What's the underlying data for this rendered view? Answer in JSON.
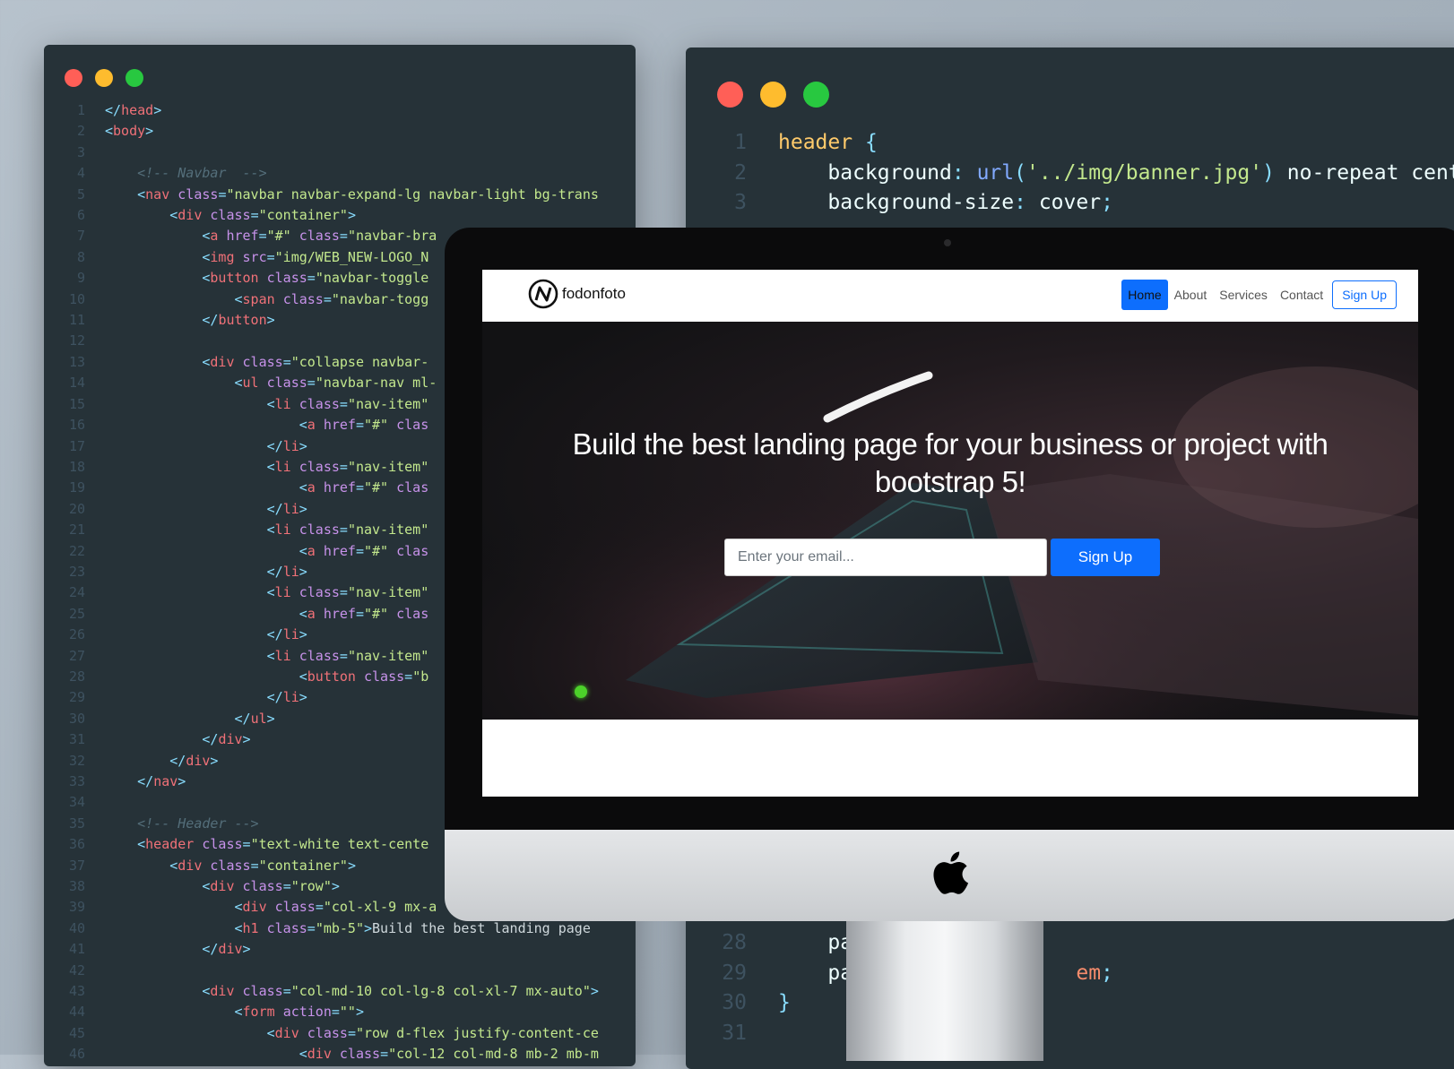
{
  "colors": {
    "dot_red": "#ff5f57",
    "dot_yellow": "#febc2e",
    "dot_green": "#28c840",
    "editor_bg": "#263238",
    "primary": "#0d6efd"
  },
  "html_editor": {
    "lines": [
      {
        "n": "1",
        "segs": [
          [
            "t-punct",
            "</"
          ],
          [
            "t-tag",
            "head"
          ],
          [
            "t-punct",
            ">"
          ]
        ],
        "indent": ""
      },
      {
        "n": "2",
        "segs": [
          [
            "t-punct",
            "<"
          ],
          [
            "t-tag",
            "body"
          ],
          [
            "t-punct",
            ">"
          ]
        ],
        "indent": ""
      },
      {
        "n": "3",
        "segs": [],
        "indent": ""
      },
      {
        "n": "4",
        "segs": [
          [
            "t-cmt",
            "<!-- Navbar  -->"
          ]
        ],
        "indent": "    "
      },
      {
        "n": "5",
        "segs": [
          [
            "t-punct",
            "<"
          ],
          [
            "t-tag",
            "nav "
          ],
          [
            "t-attr",
            "class"
          ],
          [
            "t-punct",
            "="
          ],
          [
            "t-str",
            "\"navbar navbar-expand-lg navbar-light bg-trans"
          ]
        ],
        "indent": "    "
      },
      {
        "n": "6",
        "segs": [
          [
            "t-punct",
            "<"
          ],
          [
            "t-tag",
            "div "
          ],
          [
            "t-attr",
            "class"
          ],
          [
            "t-punct",
            "="
          ],
          [
            "t-str",
            "\"container\""
          ],
          [
            "t-punct",
            ">"
          ]
        ],
        "indent": "        "
      },
      {
        "n": "7",
        "segs": [
          [
            "t-punct",
            "<"
          ],
          [
            "t-tag",
            "a "
          ],
          [
            "t-attr",
            "href"
          ],
          [
            "t-punct",
            "="
          ],
          [
            "t-str",
            "\"#\" "
          ],
          [
            "t-attr",
            "class"
          ],
          [
            "t-punct",
            "="
          ],
          [
            "t-str",
            "\"navbar-bra"
          ]
        ],
        "indent": "            "
      },
      {
        "n": "8",
        "segs": [
          [
            "t-punct",
            "<"
          ],
          [
            "t-tag",
            "img "
          ],
          [
            "t-attr",
            "src"
          ],
          [
            "t-punct",
            "="
          ],
          [
            "t-str",
            "\"img/WEB_NEW-LOGO_N"
          ]
        ],
        "indent": "            "
      },
      {
        "n": "9",
        "segs": [
          [
            "t-punct",
            "<"
          ],
          [
            "t-tag",
            "button "
          ],
          [
            "t-attr",
            "class"
          ],
          [
            "t-punct",
            "="
          ],
          [
            "t-str",
            "\"navbar-toggle"
          ]
        ],
        "indent": "            "
      },
      {
        "n": "10",
        "segs": [
          [
            "t-punct",
            "<"
          ],
          [
            "t-tag",
            "span "
          ],
          [
            "t-attr",
            "class"
          ],
          [
            "t-punct",
            "="
          ],
          [
            "t-str",
            "\"navbar-togg"
          ]
        ],
        "indent": "                "
      },
      {
        "n": "11",
        "segs": [
          [
            "t-punct",
            "</"
          ],
          [
            "t-tag",
            "button"
          ],
          [
            "t-punct",
            ">"
          ]
        ],
        "indent": "            "
      },
      {
        "n": "12",
        "segs": [],
        "indent": ""
      },
      {
        "n": "13",
        "segs": [
          [
            "t-punct",
            "<"
          ],
          [
            "t-tag",
            "div "
          ],
          [
            "t-attr",
            "class"
          ],
          [
            "t-punct",
            "="
          ],
          [
            "t-str",
            "\"collapse navbar-"
          ]
        ],
        "indent": "            "
      },
      {
        "n": "14",
        "segs": [
          [
            "t-punct",
            "<"
          ],
          [
            "t-tag",
            "ul "
          ],
          [
            "t-attr",
            "class"
          ],
          [
            "t-punct",
            "="
          ],
          [
            "t-str",
            "\"navbar-nav ml-"
          ]
        ],
        "indent": "                "
      },
      {
        "n": "15",
        "segs": [
          [
            "t-punct",
            "<"
          ],
          [
            "t-tag",
            "li "
          ],
          [
            "t-attr",
            "class"
          ],
          [
            "t-punct",
            "="
          ],
          [
            "t-str",
            "\"nav-item\""
          ]
        ],
        "indent": "                    "
      },
      {
        "n": "16",
        "segs": [
          [
            "t-punct",
            "<"
          ],
          [
            "t-tag",
            "a "
          ],
          [
            "t-attr",
            "href"
          ],
          [
            "t-punct",
            "="
          ],
          [
            "t-str",
            "\"#\" "
          ],
          [
            "t-attr",
            "clas"
          ]
        ],
        "indent": "                        "
      },
      {
        "n": "17",
        "segs": [
          [
            "t-punct",
            "</"
          ],
          [
            "t-tag",
            "li"
          ],
          [
            "t-punct",
            ">"
          ]
        ],
        "indent": "                    "
      },
      {
        "n": "18",
        "segs": [
          [
            "t-punct",
            "<"
          ],
          [
            "t-tag",
            "li "
          ],
          [
            "t-attr",
            "class"
          ],
          [
            "t-punct",
            "="
          ],
          [
            "t-str",
            "\"nav-item\""
          ]
        ],
        "indent": "                    "
      },
      {
        "n": "19",
        "segs": [
          [
            "t-punct",
            "<"
          ],
          [
            "t-tag",
            "a "
          ],
          [
            "t-attr",
            "href"
          ],
          [
            "t-punct",
            "="
          ],
          [
            "t-str",
            "\"#\" "
          ],
          [
            "t-attr",
            "clas"
          ]
        ],
        "indent": "                        "
      },
      {
        "n": "20",
        "segs": [
          [
            "t-punct",
            "</"
          ],
          [
            "t-tag",
            "li"
          ],
          [
            "t-punct",
            ">"
          ]
        ],
        "indent": "                    "
      },
      {
        "n": "21",
        "segs": [
          [
            "t-punct",
            "<"
          ],
          [
            "t-tag",
            "li "
          ],
          [
            "t-attr",
            "class"
          ],
          [
            "t-punct",
            "="
          ],
          [
            "t-str",
            "\"nav-item\""
          ]
        ],
        "indent": "                    "
      },
      {
        "n": "22",
        "segs": [
          [
            "t-punct",
            "<"
          ],
          [
            "t-tag",
            "a "
          ],
          [
            "t-attr",
            "href"
          ],
          [
            "t-punct",
            "="
          ],
          [
            "t-str",
            "\"#\" "
          ],
          [
            "t-attr",
            "clas"
          ]
        ],
        "indent": "                        "
      },
      {
        "n": "23",
        "segs": [
          [
            "t-punct",
            "</"
          ],
          [
            "t-tag",
            "li"
          ],
          [
            "t-punct",
            ">"
          ]
        ],
        "indent": "                    "
      },
      {
        "n": "24",
        "segs": [
          [
            "t-punct",
            "<"
          ],
          [
            "t-tag",
            "li "
          ],
          [
            "t-attr",
            "class"
          ],
          [
            "t-punct",
            "="
          ],
          [
            "t-str",
            "\"nav-item\""
          ]
        ],
        "indent": "                    "
      },
      {
        "n": "25",
        "segs": [
          [
            "t-punct",
            "<"
          ],
          [
            "t-tag",
            "a "
          ],
          [
            "t-attr",
            "href"
          ],
          [
            "t-punct",
            "="
          ],
          [
            "t-str",
            "\"#\" "
          ],
          [
            "t-attr",
            "clas"
          ]
        ],
        "indent": "                        "
      },
      {
        "n": "26",
        "segs": [
          [
            "t-punct",
            "</"
          ],
          [
            "t-tag",
            "li"
          ],
          [
            "t-punct",
            ">"
          ]
        ],
        "indent": "                    "
      },
      {
        "n": "27",
        "segs": [
          [
            "t-punct",
            "<"
          ],
          [
            "t-tag",
            "li "
          ],
          [
            "t-attr",
            "class"
          ],
          [
            "t-punct",
            "="
          ],
          [
            "t-str",
            "\"nav-item\""
          ]
        ],
        "indent": "                    "
      },
      {
        "n": "28",
        "segs": [
          [
            "t-punct",
            "<"
          ],
          [
            "t-tag",
            "button "
          ],
          [
            "t-attr",
            "class"
          ],
          [
            "t-punct",
            "="
          ],
          [
            "t-str",
            "\"b"
          ]
        ],
        "indent": "                        "
      },
      {
        "n": "29",
        "segs": [
          [
            "t-punct",
            "</"
          ],
          [
            "t-tag",
            "li"
          ],
          [
            "t-punct",
            ">"
          ]
        ],
        "indent": "                    "
      },
      {
        "n": "30",
        "segs": [
          [
            "t-punct",
            "</"
          ],
          [
            "t-tag",
            "ul"
          ],
          [
            "t-punct",
            ">"
          ]
        ],
        "indent": "                "
      },
      {
        "n": "31",
        "segs": [
          [
            "t-punct",
            "</"
          ],
          [
            "t-tag",
            "div"
          ],
          [
            "t-punct",
            ">"
          ]
        ],
        "indent": "            "
      },
      {
        "n": "32",
        "segs": [
          [
            "t-punct",
            "</"
          ],
          [
            "t-tag",
            "div"
          ],
          [
            "t-punct",
            ">"
          ]
        ],
        "indent": "        "
      },
      {
        "n": "33",
        "segs": [
          [
            "t-punct",
            "</"
          ],
          [
            "t-tag",
            "nav"
          ],
          [
            "t-punct",
            ">"
          ]
        ],
        "indent": "    "
      },
      {
        "n": "34",
        "segs": [],
        "indent": ""
      },
      {
        "n": "35",
        "segs": [
          [
            "t-cmt",
            "<!-- Header -->"
          ]
        ],
        "indent": "    "
      },
      {
        "n": "36",
        "segs": [
          [
            "t-punct",
            "<"
          ],
          [
            "t-tag",
            "header "
          ],
          [
            "t-attr",
            "class"
          ],
          [
            "t-punct",
            "="
          ],
          [
            "t-str",
            "\"text-white text-cente"
          ]
        ],
        "indent": "    "
      },
      {
        "n": "37",
        "segs": [
          [
            "t-punct",
            "<"
          ],
          [
            "t-tag",
            "div "
          ],
          [
            "t-attr",
            "class"
          ],
          [
            "t-punct",
            "="
          ],
          [
            "t-str",
            "\"container\""
          ],
          [
            "t-punct",
            ">"
          ]
        ],
        "indent": "        "
      },
      {
        "n": "38",
        "segs": [
          [
            "t-punct",
            "<"
          ],
          [
            "t-tag",
            "div "
          ],
          [
            "t-attr",
            "class"
          ],
          [
            "t-punct",
            "="
          ],
          [
            "t-str",
            "\"row\""
          ],
          [
            "t-punct",
            ">"
          ]
        ],
        "indent": "            "
      },
      {
        "n": "39",
        "segs": [
          [
            "t-punct",
            "<"
          ],
          [
            "t-tag",
            "div "
          ],
          [
            "t-attr",
            "class"
          ],
          [
            "t-punct",
            "="
          ],
          [
            "t-str",
            "\"col-xl-9 mx-a"
          ]
        ],
        "indent": "                "
      },
      {
        "n": "40",
        "segs": [
          [
            "t-punct",
            "<"
          ],
          [
            "t-tag",
            "h1 "
          ],
          [
            "t-attr",
            "class"
          ],
          [
            "t-punct",
            "="
          ],
          [
            "t-str",
            "\"mb-5\""
          ],
          [
            "t-punct",
            ">"
          ],
          [
            "tx",
            "Build the best landing page"
          ]
        ],
        "indent": "                "
      },
      {
        "n": "41",
        "segs": [
          [
            "t-punct",
            "</"
          ],
          [
            "t-tag",
            "div"
          ],
          [
            "t-punct",
            ">"
          ]
        ],
        "indent": "            "
      },
      {
        "n": "42",
        "segs": [],
        "indent": ""
      },
      {
        "n": "43",
        "segs": [
          [
            "t-punct",
            "<"
          ],
          [
            "t-tag",
            "div "
          ],
          [
            "t-attr",
            "class"
          ],
          [
            "t-punct",
            "="
          ],
          [
            "t-str",
            "\"col-md-10 col-lg-8 col-xl-7 mx-auto\""
          ],
          [
            "t-punct",
            ">"
          ]
        ],
        "indent": "            "
      },
      {
        "n": "44",
        "segs": [
          [
            "t-punct",
            "<"
          ],
          [
            "t-tag",
            "form "
          ],
          [
            "t-attr",
            "action"
          ],
          [
            "t-punct",
            "="
          ],
          [
            "t-str",
            "\"\""
          ],
          [
            "t-punct",
            ">"
          ]
        ],
        "indent": "                "
      },
      {
        "n": "45",
        "segs": [
          [
            "t-punct",
            "<"
          ],
          [
            "t-tag",
            "div "
          ],
          [
            "t-attr",
            "class"
          ],
          [
            "t-punct",
            "="
          ],
          [
            "t-str",
            "\"row d-flex justify-content-ce"
          ]
        ],
        "indent": "                    "
      },
      {
        "n": "46",
        "segs": [
          [
            "t-punct",
            "<"
          ],
          [
            "t-tag",
            "div "
          ],
          [
            "t-attr",
            "class"
          ],
          [
            "t-punct",
            "="
          ],
          [
            "t-str",
            "\"col-12 col-md-8 mb-2 mb-m"
          ]
        ],
        "indent": "                        "
      }
    ]
  },
  "css_editor": {
    "lines": [
      {
        "n": "1",
        "segs": [
          [
            "t-sel",
            "header "
          ],
          [
            "t-punct",
            "{"
          ]
        ],
        "indent": ""
      },
      {
        "n": "2",
        "segs": [
          [
            "t-prop",
            "background"
          ],
          [
            "t-punct",
            ": "
          ],
          [
            "t-fn",
            "url"
          ],
          [
            "t-punct",
            "("
          ],
          [
            "t-str",
            "'../img/banner.jpg'"
          ],
          [
            "t-punct",
            ")"
          ],
          [
            "t-prop",
            " no-repeat cente"
          ]
        ],
        "indent": "    "
      },
      {
        "n": "3",
        "segs": [
          [
            "t-prop",
            "background-size"
          ],
          [
            "t-punct",
            ": "
          ],
          [
            "t-prop",
            "cover"
          ],
          [
            "t-punct",
            ";"
          ]
        ],
        "indent": "    "
      }
    ],
    "bottom_lines": [
      {
        "n": "28",
        "segs": [
          [
            "t-prop",
            "pa"
          ]
        ],
        "indent": "    "
      },
      {
        "n": "29",
        "segs": [
          [
            "t-prop",
            "pa"
          ],
          [
            "t-prop",
            "                  "
          ],
          [
            "t-num",
            "em"
          ],
          [
            "t-punct",
            ";"
          ]
        ],
        "indent": "    "
      },
      {
        "n": "30",
        "segs": [
          [
            "t-punct",
            "}"
          ]
        ],
        "indent": ""
      },
      {
        "n": "31",
        "segs": [],
        "indent": ""
      }
    ]
  },
  "site": {
    "brand": "fodonfoto",
    "nav": [
      "Home",
      "About",
      "Services",
      "Contact"
    ],
    "nav_signup": "Sign Up",
    "hero_title": "Build the best landing page for your business or project with bootstrap 5!",
    "email_placeholder": "Enter your email...",
    "hero_signup": "Sign Up"
  }
}
